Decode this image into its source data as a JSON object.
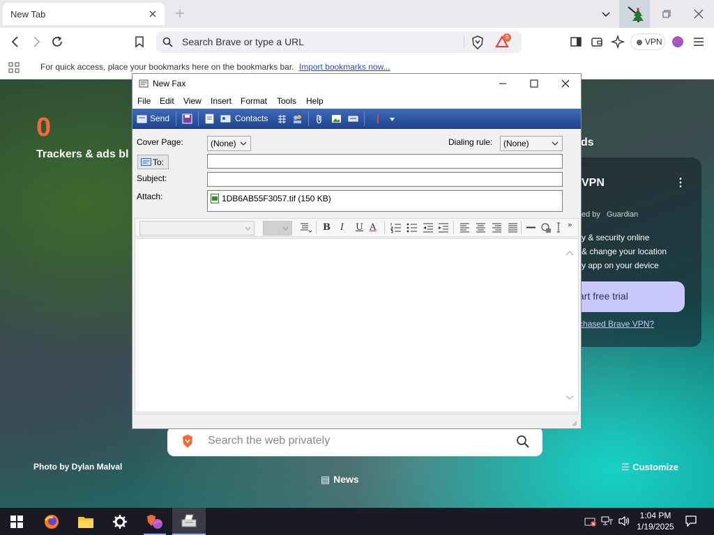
{
  "browser": {
    "tab_title": "New Tab",
    "url_placeholder": "Search Brave or type a URL",
    "shield_badge": "9",
    "vpn_label": "VPN",
    "bookmarks_hint": "For quick access, place your bookmarks here on the bookmarks bar.",
    "import_link": "Import bookmarks now..."
  },
  "ntp": {
    "tracker_count": "0",
    "tracker_label": "Trackers & ads bl",
    "right_label": "ds",
    "vpn_card": {
      "title": "VPN",
      "menu": "⋮",
      "powered_by": "ed by",
      "powered_brand": "Guardian",
      "line1": "y & security online",
      "line2": "& change your location",
      "line3": "y app on your device",
      "cta": "art free trial",
      "link": "rchased Brave VPN?"
    },
    "search_placeholder": "Search the web privately",
    "photo_credit": "Photo by Dylan Malval",
    "customize": "Customize",
    "news": "News"
  },
  "fax": {
    "title": "New Fax",
    "menu": [
      "File",
      "Edit",
      "View",
      "Insert",
      "Format",
      "Tools",
      "Help"
    ],
    "toolbar": {
      "send": "Send",
      "contacts": "Contacts"
    },
    "cover_page_label": "Cover Page:",
    "cover_page_value": "(None)",
    "dialing_rule_label": "Dialing rule:",
    "dialing_rule_value": "(None)",
    "to_label": "To:",
    "subject_label": "Subject:",
    "attach_label": "Attach:",
    "attachment": "1DB6AB55F3057.tif (150 KB)",
    "format_toolbar": {
      "bold": "B",
      "italic": "I",
      "underline": "U",
      "font_color": "A",
      "more": "»"
    }
  },
  "taskbar": {
    "time": "1:04 PM",
    "date": "1/19/2025"
  },
  "colors": {
    "brave_orange": "#f06a3c",
    "fax_toolbar_blue": "#2a55a5",
    "vpn_cta": "#c9c9ff"
  }
}
